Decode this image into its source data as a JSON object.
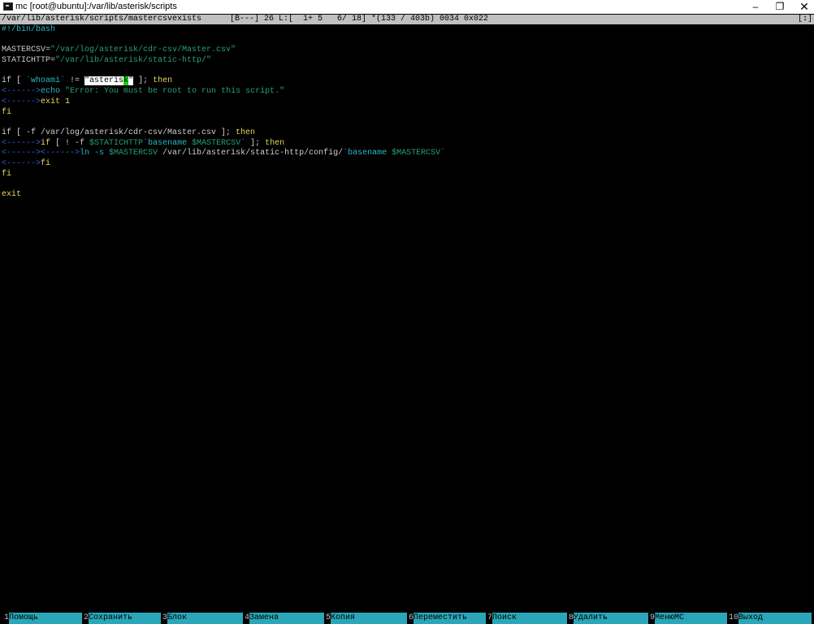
{
  "window": {
    "title": "mc [root@ubuntu]:/var/lib/asterisk/scripts",
    "controls": {
      "minimize": "–",
      "restore": "❐",
      "close": "✕"
    }
  },
  "status": {
    "path": "/var/lib/asterisk/scripts/mastercsvexists",
    "info": "[B---] 26 L:[  1+ 5   6/ 18] *(133 / 403b) 0034 0x022",
    "fullscreen": "[↕]"
  },
  "editor": {
    "lines": [
      [
        {
          "t": "#!/bin/bash",
          "c": "c"
        }
      ],
      [],
      [
        {
          "t": "MASTERCSV=",
          "c": "w"
        },
        {
          "t": "\"/var/log/asterisk/cdr-csv/Master.csv\"",
          "c": "g"
        }
      ],
      [
        {
          "t": "STATICHTTP=",
          "c": "w"
        },
        {
          "t": "\"/var/lib/asterisk/static-http/\"",
          "c": "g"
        }
      ],
      [],
      [
        {
          "t": "if [ ",
          "c": "w"
        },
        {
          "t": "`whoami`",
          "c": "c"
        },
        {
          "t": " != ",
          "c": "w"
        },
        {
          "t": "\"asteris",
          "c": "hl"
        },
        {
          "t": "k",
          "c": "cur"
        },
        {
          "t": "\"",
          "c": "hl"
        },
        {
          "t": " ]; ",
          "c": "w"
        },
        {
          "t": "then",
          "c": "y"
        }
      ],
      [
        {
          "t": "<------>",
          "c": "b"
        },
        {
          "t": "echo ",
          "c": "c"
        },
        {
          "t": "\"Error: You must be root to run this script.\"",
          "c": "g"
        }
      ],
      [
        {
          "t": "<------>",
          "c": "b"
        },
        {
          "t": "exit 1",
          "c": "y"
        }
      ],
      [
        {
          "t": "fi",
          "c": "y"
        }
      ],
      [],
      [
        {
          "t": "if [ -f /var/log/asterisk/cdr-csv/Master.csv ]; ",
          "c": "w"
        },
        {
          "t": "then",
          "c": "y"
        }
      ],
      [
        {
          "t": "<------>",
          "c": "b"
        },
        {
          "t": "if",
          "c": "y"
        },
        {
          "t": " [ ! -f ",
          "c": "w"
        },
        {
          "t": "$STATICHTTP",
          "c": "g"
        },
        {
          "t": "`basename ",
          "c": "c"
        },
        {
          "t": "$MASTERCSV",
          "c": "g"
        },
        {
          "t": "`",
          "c": "c"
        },
        {
          "t": " ]; ",
          "c": "w"
        },
        {
          "t": "then",
          "c": "y"
        }
      ],
      [
        {
          "t": "<------><------>",
          "c": "b"
        },
        {
          "t": "ln -s ",
          "c": "c"
        },
        {
          "t": "$MASTERCSV",
          "c": "g"
        },
        {
          "t": " /var/lib/asterisk/static-http/config/",
          "c": "w"
        },
        {
          "t": "`basename ",
          "c": "c"
        },
        {
          "t": "$MASTERCSV",
          "c": "g"
        },
        {
          "t": "`",
          "c": "c"
        }
      ],
      [
        {
          "t": "<------>",
          "c": "b"
        },
        {
          "t": "fi",
          "c": "y"
        }
      ],
      [
        {
          "t": "fi",
          "c": "y"
        }
      ],
      [],
      [
        {
          "t": "exit",
          "c": "y"
        }
      ]
    ]
  },
  "fkeys": [
    {
      "num": "1",
      "label": "Помощь"
    },
    {
      "num": "2",
      "label": "Сохранить"
    },
    {
      "num": "3",
      "label": "Блок"
    },
    {
      "num": "4",
      "label": "Замена"
    },
    {
      "num": "5",
      "label": "Копия"
    },
    {
      "num": "6",
      "label": "Переместить"
    },
    {
      "num": "7",
      "label": "Поиск"
    },
    {
      "num": "8",
      "label": "Удалить"
    },
    {
      "num": "9",
      "label": "МенюMC"
    },
    {
      "num": "10",
      "label": "Выход"
    }
  ],
  "colors": {
    "background": "#000000",
    "status_bar": "#c0c0c0",
    "fkey_label_bg": "#2aa6b8",
    "cursor": "#00e000"
  }
}
